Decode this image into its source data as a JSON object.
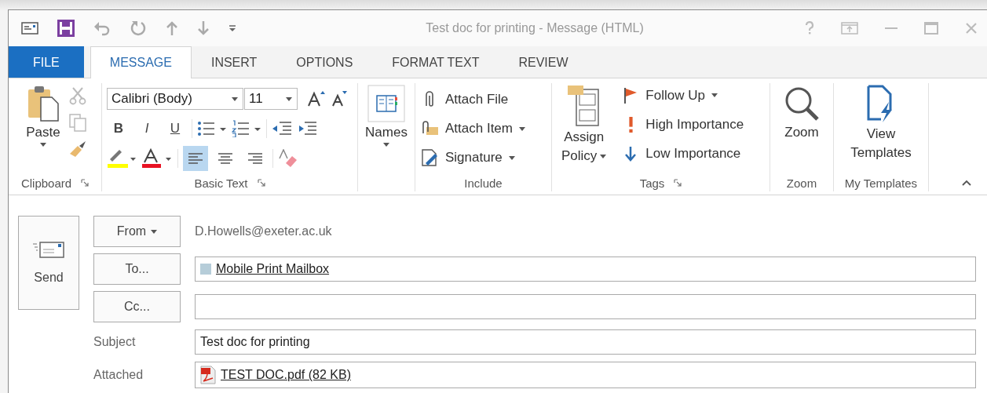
{
  "window": {
    "title": "Test doc for printing - Message (HTML)"
  },
  "tabs": [
    {
      "label": "FILE",
      "kind": "file",
      "selected": false
    },
    {
      "label": "MESSAGE",
      "kind": "tab",
      "selected": true
    },
    {
      "label": "INSERT",
      "kind": "tab",
      "selected": false
    },
    {
      "label": "OPTIONS",
      "kind": "tab",
      "selected": false
    },
    {
      "label": "FORMAT TEXT",
      "kind": "tab",
      "selected": false
    },
    {
      "label": "REVIEW",
      "kind": "tab",
      "selected": false
    }
  ],
  "clipboard": {
    "paste": "Paste",
    "label": "Clipboard"
  },
  "basic_text": {
    "font": "Calibri (Body)",
    "size": "11",
    "bold": "B",
    "italic": "I",
    "underline": "U",
    "align_buttons": [
      {
        "kind": "left",
        "selected": true
      },
      {
        "kind": "center",
        "selected": false
      },
      {
        "kind": "right",
        "selected": false
      }
    ],
    "label": "Basic Text"
  },
  "names": {
    "label": "Names"
  },
  "include": {
    "items": [
      {
        "label": "Attach File",
        "kind": "clip",
        "dropdown": false
      },
      {
        "label": "Attach Item",
        "kind": "item",
        "dropdown": true
      },
      {
        "label": "Signature",
        "kind": "signature",
        "dropdown": true
      }
    ],
    "label": "Include"
  },
  "tags": {
    "assign": [
      "Assign",
      "Policy"
    ],
    "items": [
      {
        "label": "Follow Up",
        "kind": "flag",
        "dropdown": true
      },
      {
        "label": "High Importance",
        "kind": "high",
        "dropdown": false
      },
      {
        "label": "Low Importance",
        "kind": "low",
        "dropdown": false
      }
    ],
    "label": "Tags"
  },
  "zoom": {
    "button": "Zoom",
    "label": "Zoom"
  },
  "my_templates": {
    "button": [
      "View",
      "Templates"
    ],
    "label": "My Templates"
  },
  "compose": {
    "send": "Send",
    "from_button": "From",
    "from_value": "D.Howells@exeter.ac.uk",
    "to_button": "To...",
    "to_recipient": "Mobile Print Mailbox",
    "cc_button": "Cc...",
    "subject_label": "Subject",
    "subject_value": "Test doc for printing",
    "attached_label": "Attached",
    "attachment": "TEST DOC.pdf (82 KB)"
  }
}
